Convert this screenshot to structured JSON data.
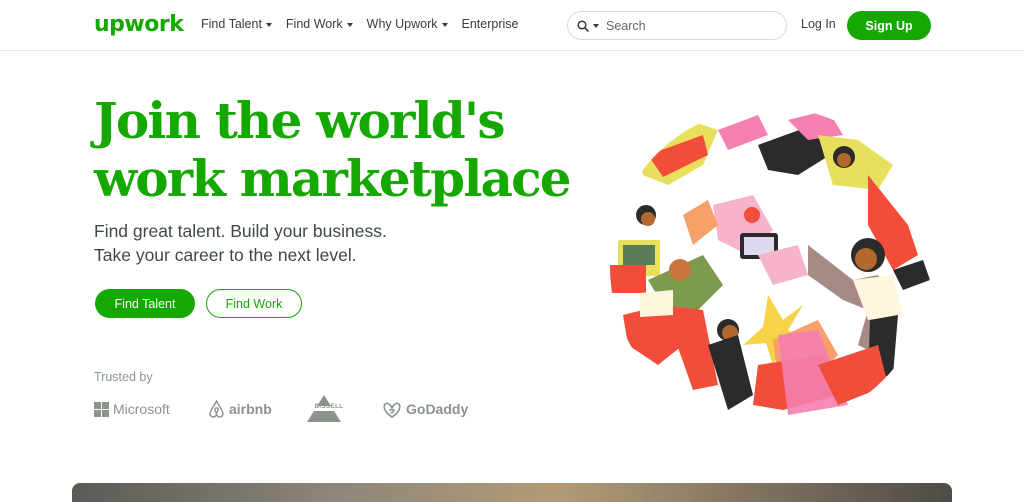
{
  "header": {
    "logo": "upwork",
    "nav": [
      {
        "label": "Find Talent",
        "has_dropdown": true
      },
      {
        "label": "Find Work",
        "has_dropdown": true
      },
      {
        "label": "Why Upwork",
        "has_dropdown": true
      },
      {
        "label": "Enterprise",
        "has_dropdown": false
      }
    ],
    "search": {
      "placeholder": "Search",
      "icon": "search-icon"
    },
    "login_label": "Log In",
    "signup_label": "Sign Up"
  },
  "hero": {
    "title_line1": "Join the world's",
    "title_line2": "work marketplace",
    "subtitle_line1": "Find great talent. Build your business.",
    "subtitle_line2": "Take your career to the next level.",
    "primary_button": "Find Talent",
    "secondary_button": "Find Work"
  },
  "trusted": {
    "label": "Trusted by",
    "logos": [
      "Microsoft",
      "airbnb",
      "BISSELL",
      "GoDaddy"
    ]
  },
  "colors": {
    "brand_green": "#14a800",
    "muted_gray": "#8b948b"
  }
}
